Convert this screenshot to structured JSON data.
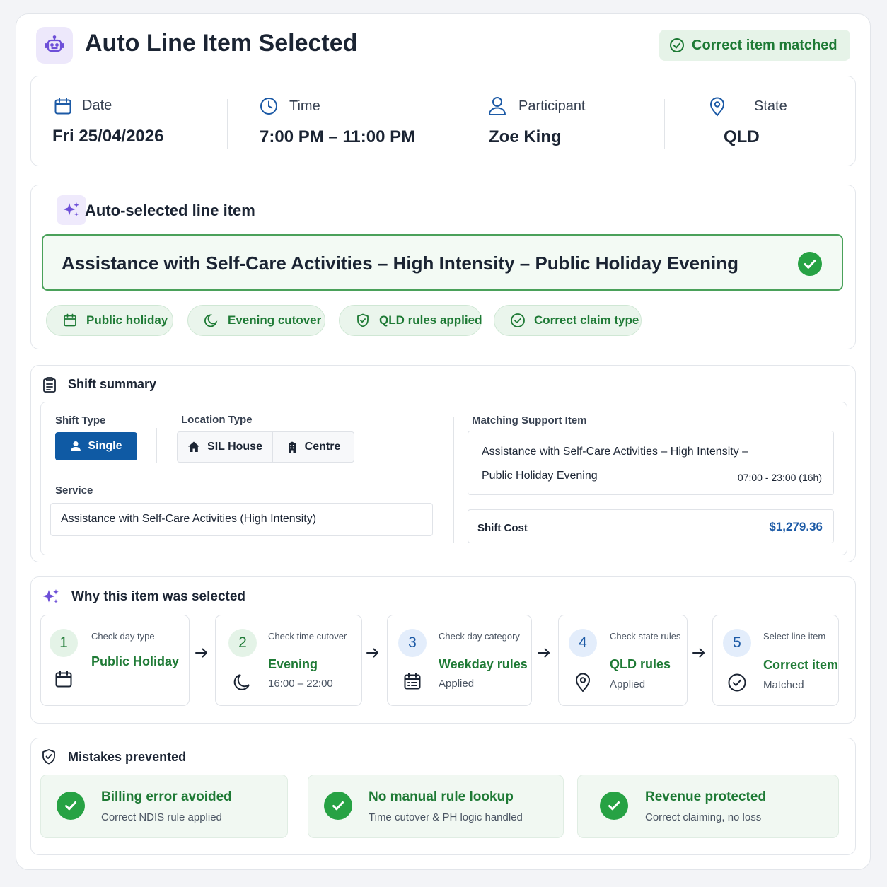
{
  "header": {
    "title": "Auto Line Item Selected",
    "match_badge": "Correct item matched"
  },
  "info": {
    "date_label": "Date",
    "date_value": "Fri 25/04/2026",
    "time_label": "Time",
    "time_value": "7:00 PM – 11:00 PM",
    "participant_label": "Participant",
    "participant_value": "Zoe King",
    "state_label": "State",
    "state_value": "QLD"
  },
  "auto_selected": {
    "title": "Auto-selected line item",
    "item": "Assistance with Self-Care Activities – High Intensity – Public Holiday Evening",
    "tags": [
      "Public holiday",
      "Evening cutover",
      "QLD rules applied",
      "Correct claim type"
    ]
  },
  "shift_summary": {
    "title": "Shift summary",
    "shift_type_label": "Shift Type",
    "shift_type_value": "Single",
    "location_type_label": "Location Type",
    "location_options": [
      "SIL House",
      "Centre"
    ],
    "service_label": "Service",
    "service_value": "Assistance with Self-Care Activities (High Intensity)",
    "matching_label": "Matching Support Item",
    "matching_line1": "Assistance with Self-Care Activities – High Intensity –",
    "matching_line2": "Public Holiday Evening",
    "matching_time": "07:00 - 23:00 (16h)",
    "cost_label": "Shift Cost",
    "cost_value": "$1,279.36"
  },
  "why": {
    "title": "Why this item was selected",
    "steps": [
      {
        "num": "1",
        "label": "Check day type",
        "value": "Public Holiday",
        "sub": ""
      },
      {
        "num": "2",
        "label": "Check time cutover",
        "value": "Evening",
        "sub": "16:00 – 22:00"
      },
      {
        "num": "3",
        "label": "Check day category",
        "value": "Weekday rules",
        "sub": "Applied"
      },
      {
        "num": "4",
        "label": "Check state rules",
        "value": "QLD rules",
        "sub": "Applied"
      },
      {
        "num": "5",
        "label": "Select line item",
        "value": "Correct item",
        "sub": "Matched"
      }
    ]
  },
  "mistakes": {
    "title": "Mistakes prevented",
    "items": [
      {
        "title": "Billing error avoided",
        "sub": "Correct NDIS rule applied"
      },
      {
        "title": "No manual rule lookup",
        "sub": "Time cutover & PH logic handled"
      },
      {
        "title": "Revenue protected",
        "sub": "Correct claiming, no loss"
      }
    ]
  },
  "colors": {
    "accent_green": "#1e7a35",
    "primary_blue": "#0f5aa4",
    "purple": "#6d4fd8"
  }
}
